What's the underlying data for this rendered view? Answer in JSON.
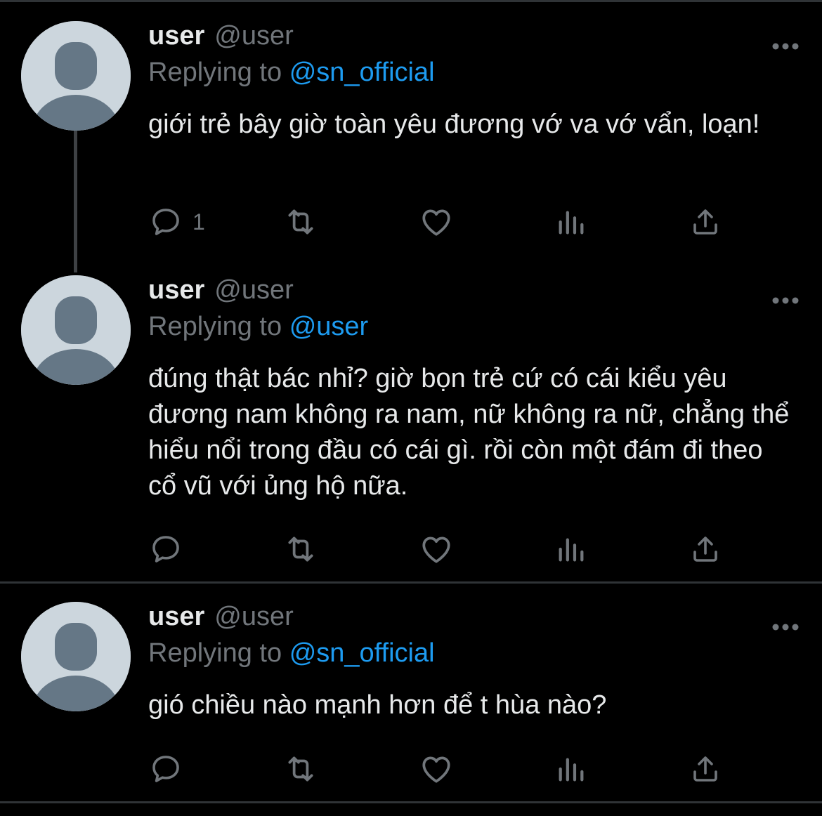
{
  "tweets": [
    {
      "name": "user",
      "handle": "@user",
      "replying_prefix": "Replying to",
      "replying_to": "@sn_official",
      "text": "giới trẻ bây giờ toàn yêu đương vớ va vớ vẩn, loạn!",
      "reply_count": "1",
      "icons": [
        "reply-icon",
        "retweet-icon",
        "like-icon",
        "analytics-icon",
        "share-icon",
        "more-icon"
      ]
    },
    {
      "name": "user",
      "handle": "@user",
      "replying_prefix": "Replying to",
      "replying_to": "@user",
      "text": "đúng thật bác nhỉ? giờ bọn trẻ cứ có cái kiểu yêu đương nam không ra nam, nữ không ra nữ, chẳng thể hiểu nổi trong đầu có cái gì. rồi còn một đám đi theo cổ vũ với ủng hộ nữa.",
      "reply_count": "",
      "icons": [
        "reply-icon",
        "retweet-icon",
        "like-icon",
        "analytics-icon",
        "share-icon",
        "more-icon"
      ]
    },
    {
      "name": "user",
      "handle": "@user",
      "replying_prefix": "Replying to",
      "replying_to": "@sn_official",
      "text": "gió chiều nào mạnh hơn để t hùa nào?",
      "reply_count": "",
      "icons": [
        "reply-icon",
        "retweet-icon",
        "like-icon",
        "analytics-icon",
        "share-icon",
        "more-icon"
      ]
    }
  ],
  "colors": {
    "background": "#000000",
    "text_primary": "#e7e9ea",
    "text_secondary": "#71767b",
    "link": "#1d9bf0",
    "divider": "#2f3336",
    "avatar_bg": "#ccd6dd",
    "avatar_fg": "#657786"
  }
}
